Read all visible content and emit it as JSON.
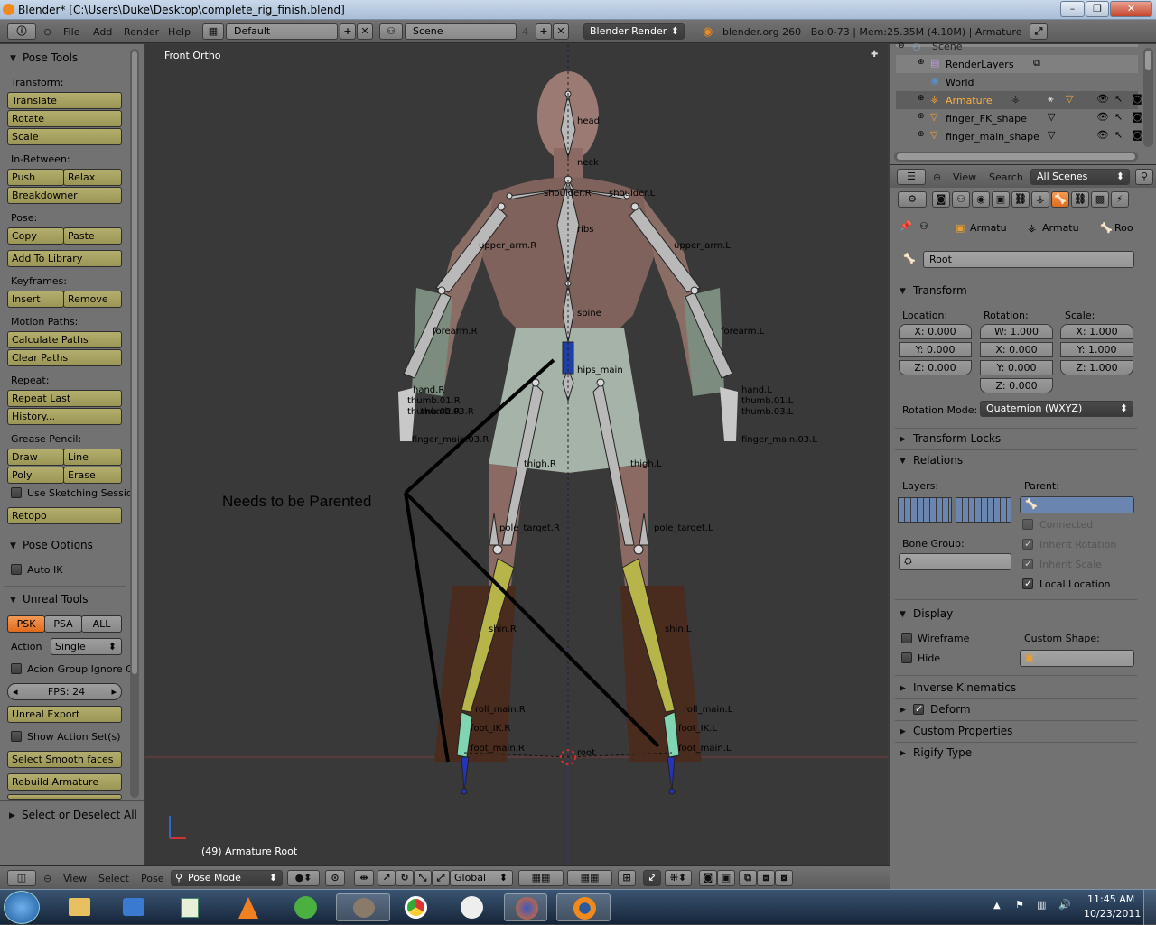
{
  "window": {
    "title": "Blender* [C:\\Users\\Duke\\Desktop\\complete_rig_finish.blend]"
  },
  "info_header": {
    "menus": [
      "File",
      "Add",
      "Render",
      "Help"
    ],
    "screen": "Default",
    "scene": "Scene",
    "scene_users": "4",
    "engine": "Blender Render",
    "stats": "blender.org 260 | Bo:0-73 | Mem:25.35M (4.10M) | Armature"
  },
  "tool_shelf": {
    "pose_tools": "Pose Tools",
    "transform_label": "Transform:",
    "translate": "Translate",
    "rotate": "Rotate",
    "scale": "Scale",
    "inbetween_label": "In-Between:",
    "push": "Push",
    "relax": "Relax",
    "breakdowner": "Breakdowner",
    "pose_label": "Pose:",
    "copy": "Copy",
    "paste": "Paste",
    "add_to_library": "Add To Library",
    "keyframes_label": "Keyframes:",
    "insert": "Insert",
    "remove": "Remove",
    "motion_label": "Motion Paths:",
    "calc_paths": "Calculate Paths",
    "clear_paths": "Clear Paths",
    "repeat_label": "Repeat:",
    "repeat_last": "Repeat Last",
    "history": "History...",
    "grease_label": "Grease Pencil:",
    "draw": "Draw",
    "line": "Line",
    "poly": "Poly",
    "erase": "Erase",
    "sketching": "Use Sketching Sessio",
    "retopo": "Retopo",
    "pose_options": "Pose Options",
    "auto_ik": "Auto IK",
    "unreal_tools": "Unreal Tools",
    "psk": "PSK",
    "psa": "PSA",
    "all": "ALL",
    "action_label": "Action",
    "action_value": "Single",
    "acion_group": "Acion Group Ignore C",
    "fps": "FPS: 24",
    "unreal_export": "Unreal Export",
    "show_action": "Show Action Set(s)",
    "select_smooth": "Select Smooth faces",
    "rebuild": "Rebuild Armature",
    "select_deselect": "Select or Deselect All"
  },
  "viewport": {
    "view_name": "Front Ortho",
    "status": "(49) Armature Root",
    "annotation": "Needs to be Parented",
    "bones": [
      {
        "t": "head"
      },
      {
        "t": "neck"
      },
      {
        "t": "shoulder.R"
      },
      {
        "t": "shoulder.L"
      },
      {
        "t": "ribs"
      },
      {
        "t": "upper_arm.R"
      },
      {
        "t": "upper_arm.L"
      },
      {
        "t": "spine"
      },
      {
        "t": "forearm.R"
      },
      {
        "t": "forearm.L"
      },
      {
        "t": "hips_main"
      },
      {
        "t": "hand.R"
      },
      {
        "t": "hand.L"
      },
      {
        "t": "thumb.01.R"
      },
      {
        "t": "thumb.02.R"
      },
      {
        "t": "thumb.03.R"
      },
      {
        "t": "finger_main.03.R"
      },
      {
        "t": "thumb.01.L"
      },
      {
        "t": "thumb.03.L"
      },
      {
        "t": "finger_main.03.L"
      },
      {
        "t": "thigh.R"
      },
      {
        "t": "thigh.L"
      },
      {
        "t": "pole_target.R"
      },
      {
        "t": "pole_target.L"
      },
      {
        "t": "shin.R"
      },
      {
        "t": "shin.L"
      },
      {
        "t": "roll_main.R"
      },
      {
        "t": "roll_main.L"
      },
      {
        "t": "foot_IK.R"
      },
      {
        "t": "foot_IK.L"
      },
      {
        "t": "foot_main.R"
      },
      {
        "t": "foot_main.L"
      },
      {
        "t": "root"
      }
    ]
  },
  "view_header": {
    "menus": [
      "View",
      "Select",
      "Pose"
    ],
    "mode": "Pose Mode",
    "orientation": "Global"
  },
  "outliner": {
    "items": [
      {
        "name": "Scene"
      },
      {
        "name": "RenderLayers"
      },
      {
        "name": "World"
      },
      {
        "name": "Armature"
      },
      {
        "name": "finger_FK_shape"
      },
      {
        "name": "finger_main_shape"
      }
    ]
  },
  "outliner_header": {
    "menus": [
      "View",
      "Search"
    ],
    "filter": "All Scenes"
  },
  "properties": {
    "breadcrumb": [
      "Armatu",
      "Armatu",
      "Roo"
    ],
    "bone_name": "Root",
    "transform": "Transform",
    "location_label": "Location:",
    "rotation_label": "Rotation:",
    "scale_label": "Scale:",
    "location": [
      "X: 0.000",
      "Y: 0.000",
      "Z: 0.000"
    ],
    "rotation": [
      "W: 1.000",
      "X: 0.000",
      "Y: 0.000",
      "Z: 0.000"
    ],
    "scale": [
      "X: 1.000",
      "Y: 1.000",
      "Z: 1.000"
    ],
    "rot_mode_label": "Rotation Mode:",
    "rot_mode": "Quaternion (WXYZ)",
    "transform_locks": "Transform Locks",
    "relations": "Relations",
    "layers_label": "Layers:",
    "parent_label": "Parent:",
    "connected": "Connected",
    "bone_group_label": "Bone Group:",
    "inherit_rotation": "Inherit Rotation",
    "inherit_scale": "Inherit Scale",
    "local_location": "Local Location",
    "display": "Display",
    "wireframe": "Wireframe",
    "hide": "Hide",
    "custom_shape_label": "Custom Shape:",
    "inverse_kinematics": "Inverse Kinematics",
    "deform": "Deform",
    "custom_properties": "Custom Properties",
    "rigify_type": "Rigify Type"
  },
  "taskbar": {
    "time": "11:45 AM",
    "date": "10/23/2011"
  }
}
